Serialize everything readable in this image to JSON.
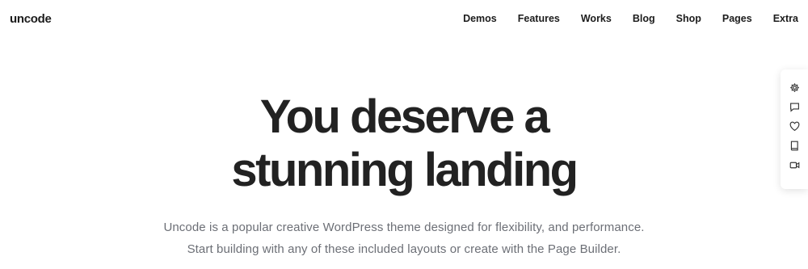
{
  "header": {
    "logo": "uncode",
    "nav": [
      "Demos",
      "Features",
      "Works",
      "Blog",
      "Shop",
      "Pages",
      "Extra"
    ]
  },
  "hero": {
    "title_line1": "You deserve a",
    "title_line2": "stunning landing",
    "subtitle_line1": "Uncode is a popular creative WordPress theme designed for flexibility, and performance.",
    "subtitle_line2": "Start building with any of these included layouts or create with the Page Builder."
  },
  "side_panel": {
    "icons": [
      "gear-icon",
      "comment-icon",
      "heart-icon",
      "book-icon",
      "video-icon"
    ]
  },
  "colors": {
    "text": "#1c1c1c",
    "heading": "#222222",
    "subtitle": "#6c6f76",
    "background": "#ffffff"
  }
}
